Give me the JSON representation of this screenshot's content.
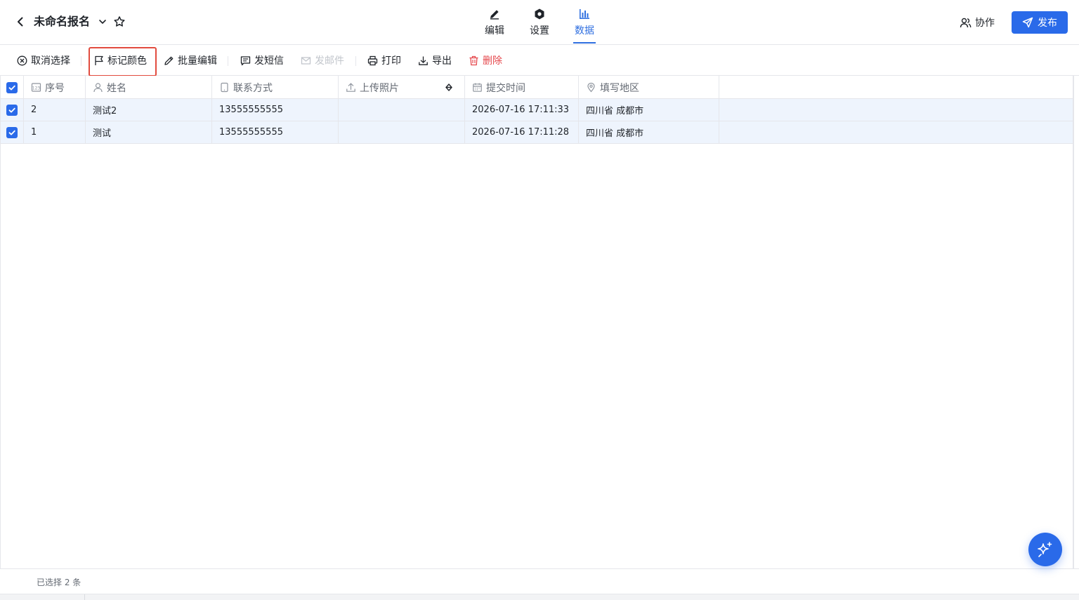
{
  "header": {
    "title": "未命名报名",
    "icons": {
      "back": "chevron-left-icon",
      "dropdown": "chevron-down-icon",
      "favorite": "star-icon"
    },
    "tabs": [
      {
        "label": "编辑",
        "icon": "pencil-icon",
        "active": false
      },
      {
        "label": "设置",
        "icon": "gear-icon",
        "active": false
      },
      {
        "label": "数据",
        "icon": "bar-chart-icon",
        "active": true
      }
    ],
    "collab_label": "协作",
    "publish_label": "发布"
  },
  "toolbar": {
    "items": [
      {
        "label": "取消选择",
        "icon": "close-circle-icon",
        "state": "normal"
      },
      {
        "label": "标记颜色",
        "icon": "flag-icon",
        "state": "highlighted"
      },
      {
        "label": "批量编辑",
        "icon": "pencil-icon",
        "state": "normal"
      },
      {
        "label": "发短信",
        "icon": "message-icon",
        "state": "normal"
      },
      {
        "label": "发邮件",
        "icon": "mail-icon",
        "state": "disabled"
      },
      {
        "label": "打印",
        "icon": "printer-icon",
        "state": "normal"
      },
      {
        "label": "导出",
        "icon": "download-icon",
        "state": "normal"
      },
      {
        "label": "删除",
        "icon": "trash-icon",
        "state": "danger"
      }
    ]
  },
  "table": {
    "columns": [
      {
        "label": "序号",
        "icon": "number-icon"
      },
      {
        "label": "姓名",
        "icon": "user-icon"
      },
      {
        "label": "联系方式",
        "icon": "phone-icon"
      },
      {
        "label": "上传照片",
        "icon": "upload-icon"
      },
      {
        "label": "提交时间",
        "icon": "calendar-icon"
      },
      {
        "label": "填写地区",
        "icon": "location-icon"
      }
    ],
    "rows": [
      {
        "checked": true,
        "no": "2",
        "name": "测试2",
        "phone": "13555555555",
        "photo": "",
        "time": "2026-07-16 17:11:33",
        "region": "四川省 成都市"
      },
      {
        "checked": true,
        "no": "1",
        "name": "测试",
        "phone": "13555555555",
        "photo": "",
        "time": "2026-07-16 17:11:28",
        "region": "四川省 成都市"
      }
    ]
  },
  "footer": {
    "selected_text": "已选择 2 条"
  },
  "colors": {
    "accent": "#2a6ae9",
    "highlight": "#e24c3f",
    "danger": "#e5484d",
    "row_selected": "#eef4fd"
  }
}
